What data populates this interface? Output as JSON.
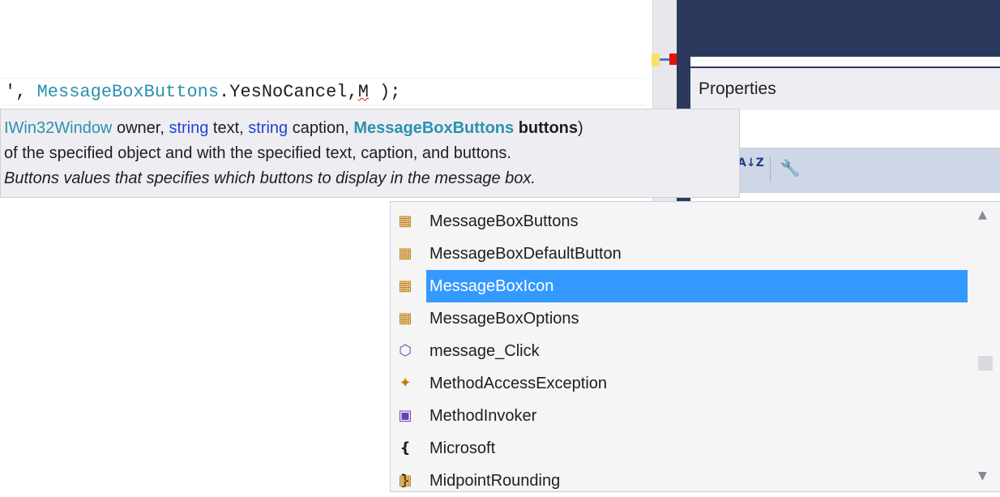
{
  "editor": {
    "code": {
      "prefix": "', ",
      "type_token": "MessageBoxButtons",
      "member": ".YesNoCancel,",
      "typed": "M",
      "suffix": " );"
    }
  },
  "tooltip": {
    "sig_type1": "IWin32Window",
    "sig_param1": " owner, ",
    "sig_kw1": "string",
    "sig_param2": " text, ",
    "sig_kw2": "string",
    "sig_param3": " caption, ",
    "sig_type2": "MessageBoxButtons",
    "sig_sp": " ",
    "sig_param4": "buttons",
    "sig_close": ")",
    "summary": "of the specified object and with the specified text, caption, and buttons.",
    "param_desc": "Buttons values that specifies which buttons to display in the message box."
  },
  "properties": {
    "title": "Properties",
    "sort_label": "A↓Z"
  },
  "completion": {
    "items": [
      {
        "icon": "enum-icon",
        "label": "MessageBoxButtons"
      },
      {
        "icon": "enum-icon",
        "label": "MessageBoxDefaultButton"
      },
      {
        "icon": "enum-icon",
        "label": "MessageBoxIcon",
        "selected": true
      },
      {
        "icon": "enum-icon",
        "label": "MessageBoxOptions"
      },
      {
        "icon": "private-method-icon",
        "label": "message_Click"
      },
      {
        "icon": "exception-class-icon",
        "label": "MethodAccessException"
      },
      {
        "icon": "delegate-icon",
        "label": "MethodInvoker"
      },
      {
        "icon": "namespace-icon",
        "label": "Microsoft"
      },
      {
        "icon": "enum-icon",
        "label": "MidpointRounding"
      }
    ]
  },
  "colors": {
    "selection": "#3399ff",
    "type_color": "#2b91af",
    "keyword": "#2442d6",
    "panel_dark": "#2b3a5c"
  }
}
